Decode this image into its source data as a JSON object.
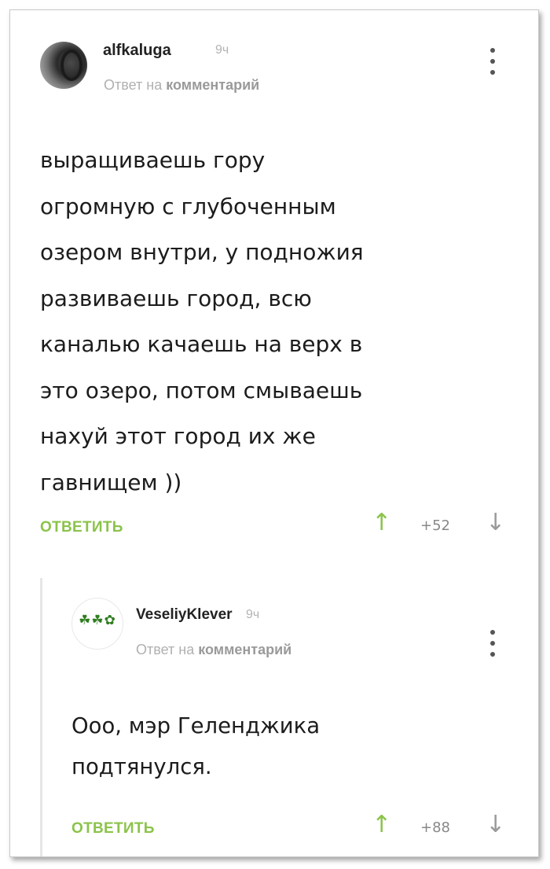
{
  "comments": [
    {
      "username": "alfkaluga",
      "time": "9ч",
      "reply_note_prefix": "Ответ на",
      "reply_note_link": "комментарий",
      "body": "выращиваешь гору\nогромную с глубоченным\nозером внутри, у подножия\nразвиваешь город, всю\nканалью качаешь на верх в\nэто озеро, потом смываешь\nнахуй этот город их же\nгавнищем ))",
      "reply_label": "ОТВЕТИТЬ",
      "up_icon": "↑",
      "rating": "+52",
      "down_icon": "↓",
      "avatar_icon": "avatar-photo"
    },
    {
      "username": "VeseliyKlever",
      "time": "9ч",
      "reply_note_prefix": "Ответ на",
      "reply_note_link": "комментарий",
      "body": "Ооо, мэр Геленджика\nподтянулся.",
      "reply_label": "ОТВЕТИТЬ",
      "up_icon": "↑",
      "rating": "+88",
      "down_icon": "↓",
      "avatar_icon": "clover-leaves"
    }
  ],
  "colors": {
    "accent": "#8bc34a",
    "text": "#1c1c1c",
    "muted": "#b0b0b0"
  }
}
